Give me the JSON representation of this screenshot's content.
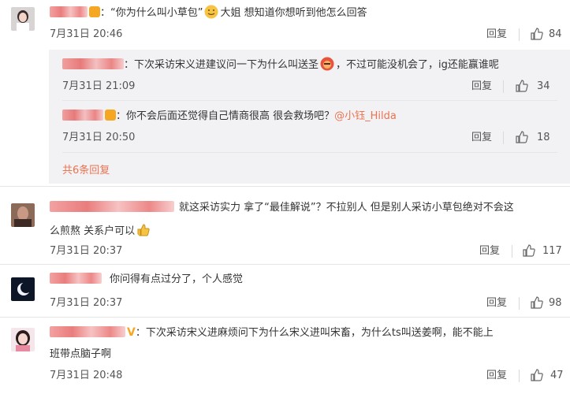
{
  "comments": [
    {
      "text": "：“你为什么叫小草包”",
      "text2": "大姐 想知道你想听到他怎么回答",
      "time": "7月31日 20:46",
      "reply_label": "回复",
      "likes": "84"
    },
    {
      "text": "就这采访实力 拿了“最佳解说”？不拉别人 但是别人采访小草包绝对不会这",
      "text2": "么煎熬 关系户可以",
      "time": "7月31日 20:37",
      "reply_label": "回复",
      "likes": "117"
    },
    {
      "text": "你问得有点过分了，个人感觉",
      "time": "7月31日 20:37",
      "reply_label": "回复",
      "likes": "98"
    },
    {
      "text": "：下次采访宋义进麻烦问下为什么宋义进叫宋畜，为什么ts叫送姜啊，能不能上",
      "text2": "班带点脑子啊",
      "time": "7月31日 20:48",
      "reply_label": "回复",
      "likes": "47"
    }
  ],
  "sub_replies": [
    {
      "text": "：下次采访宋义进建议问一下为什么叫送圣",
      "text2": "，不过可能没机会了，ig还能赢谁呢",
      "time": "7月31日 21:09",
      "reply_label": "回复",
      "likes": "34"
    },
    {
      "text": "：你不会后面还觉得自己情商很高 很会救场吧？",
      "mention": "@小钰_Hilda",
      "time": "7月31日 20:50",
      "reply_label": "回复",
      "likes": "18"
    }
  ],
  "more_replies_label": "共6条回复",
  "colors": {
    "accent": "#eb7350",
    "subbox_bg": "#f2f2f5",
    "vip": "#f5a623"
  }
}
